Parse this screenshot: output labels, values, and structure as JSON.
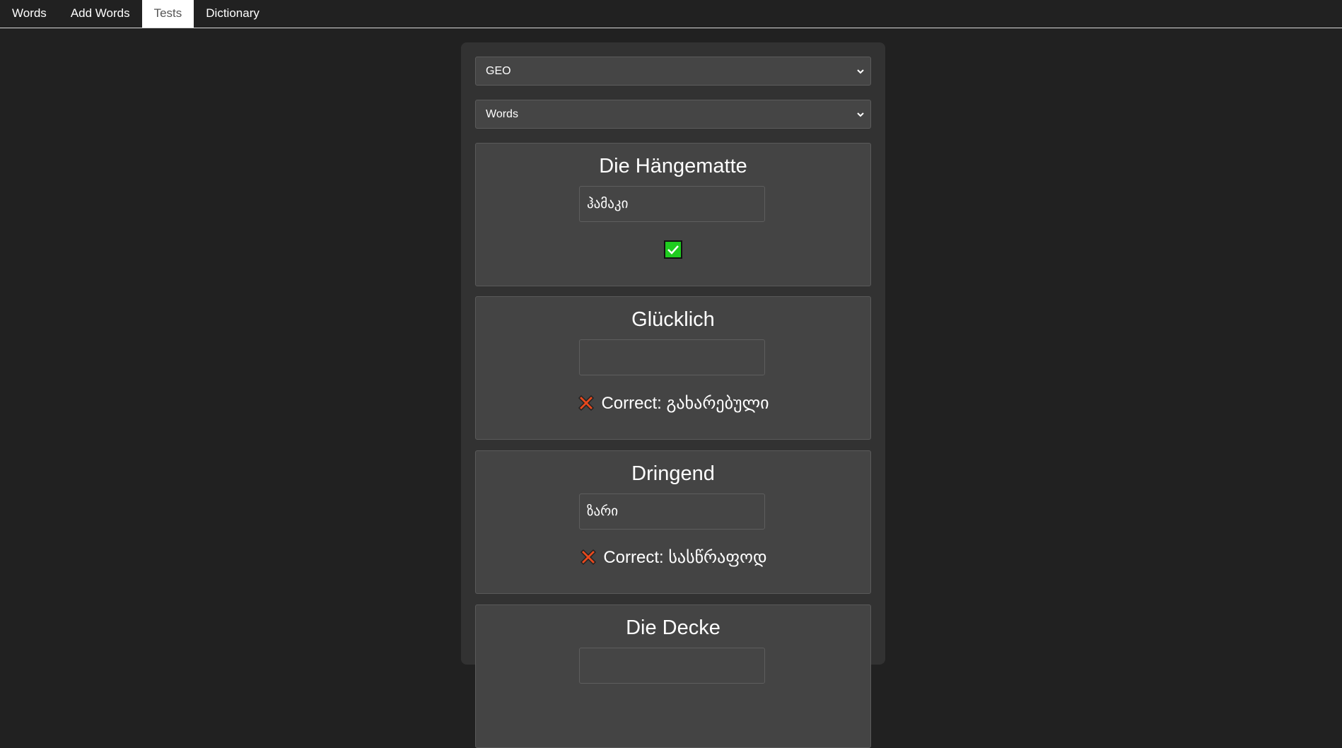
{
  "tabs": [
    {
      "label": "Words",
      "active": false
    },
    {
      "label": "Add Words",
      "active": false
    },
    {
      "label": "Tests",
      "active": true
    },
    {
      "label": "Dictionary",
      "active": false
    }
  ],
  "language_select": {
    "value": "GEO"
  },
  "mode_select": {
    "value": "Words"
  },
  "cards": [
    {
      "word": "Die Hängematte",
      "answer": "ჰამაკი",
      "result": "correct",
      "result_text": ""
    },
    {
      "word": "Glücklich",
      "answer": "",
      "result": "wrong",
      "result_text": "Correct: გახარებული"
    },
    {
      "word": "Dringend",
      "answer": "ზარი",
      "result": "wrong",
      "result_text": "Correct: სასწრაფოდ"
    },
    {
      "word": "Die Decke",
      "answer": "",
      "result": "",
      "result_text": ""
    }
  ],
  "colors": {
    "background": "#212121",
    "panel": "#323232",
    "card": "#444444",
    "correct_icon": "#1fcc1f",
    "wrong_icon": "#e8491d"
  }
}
